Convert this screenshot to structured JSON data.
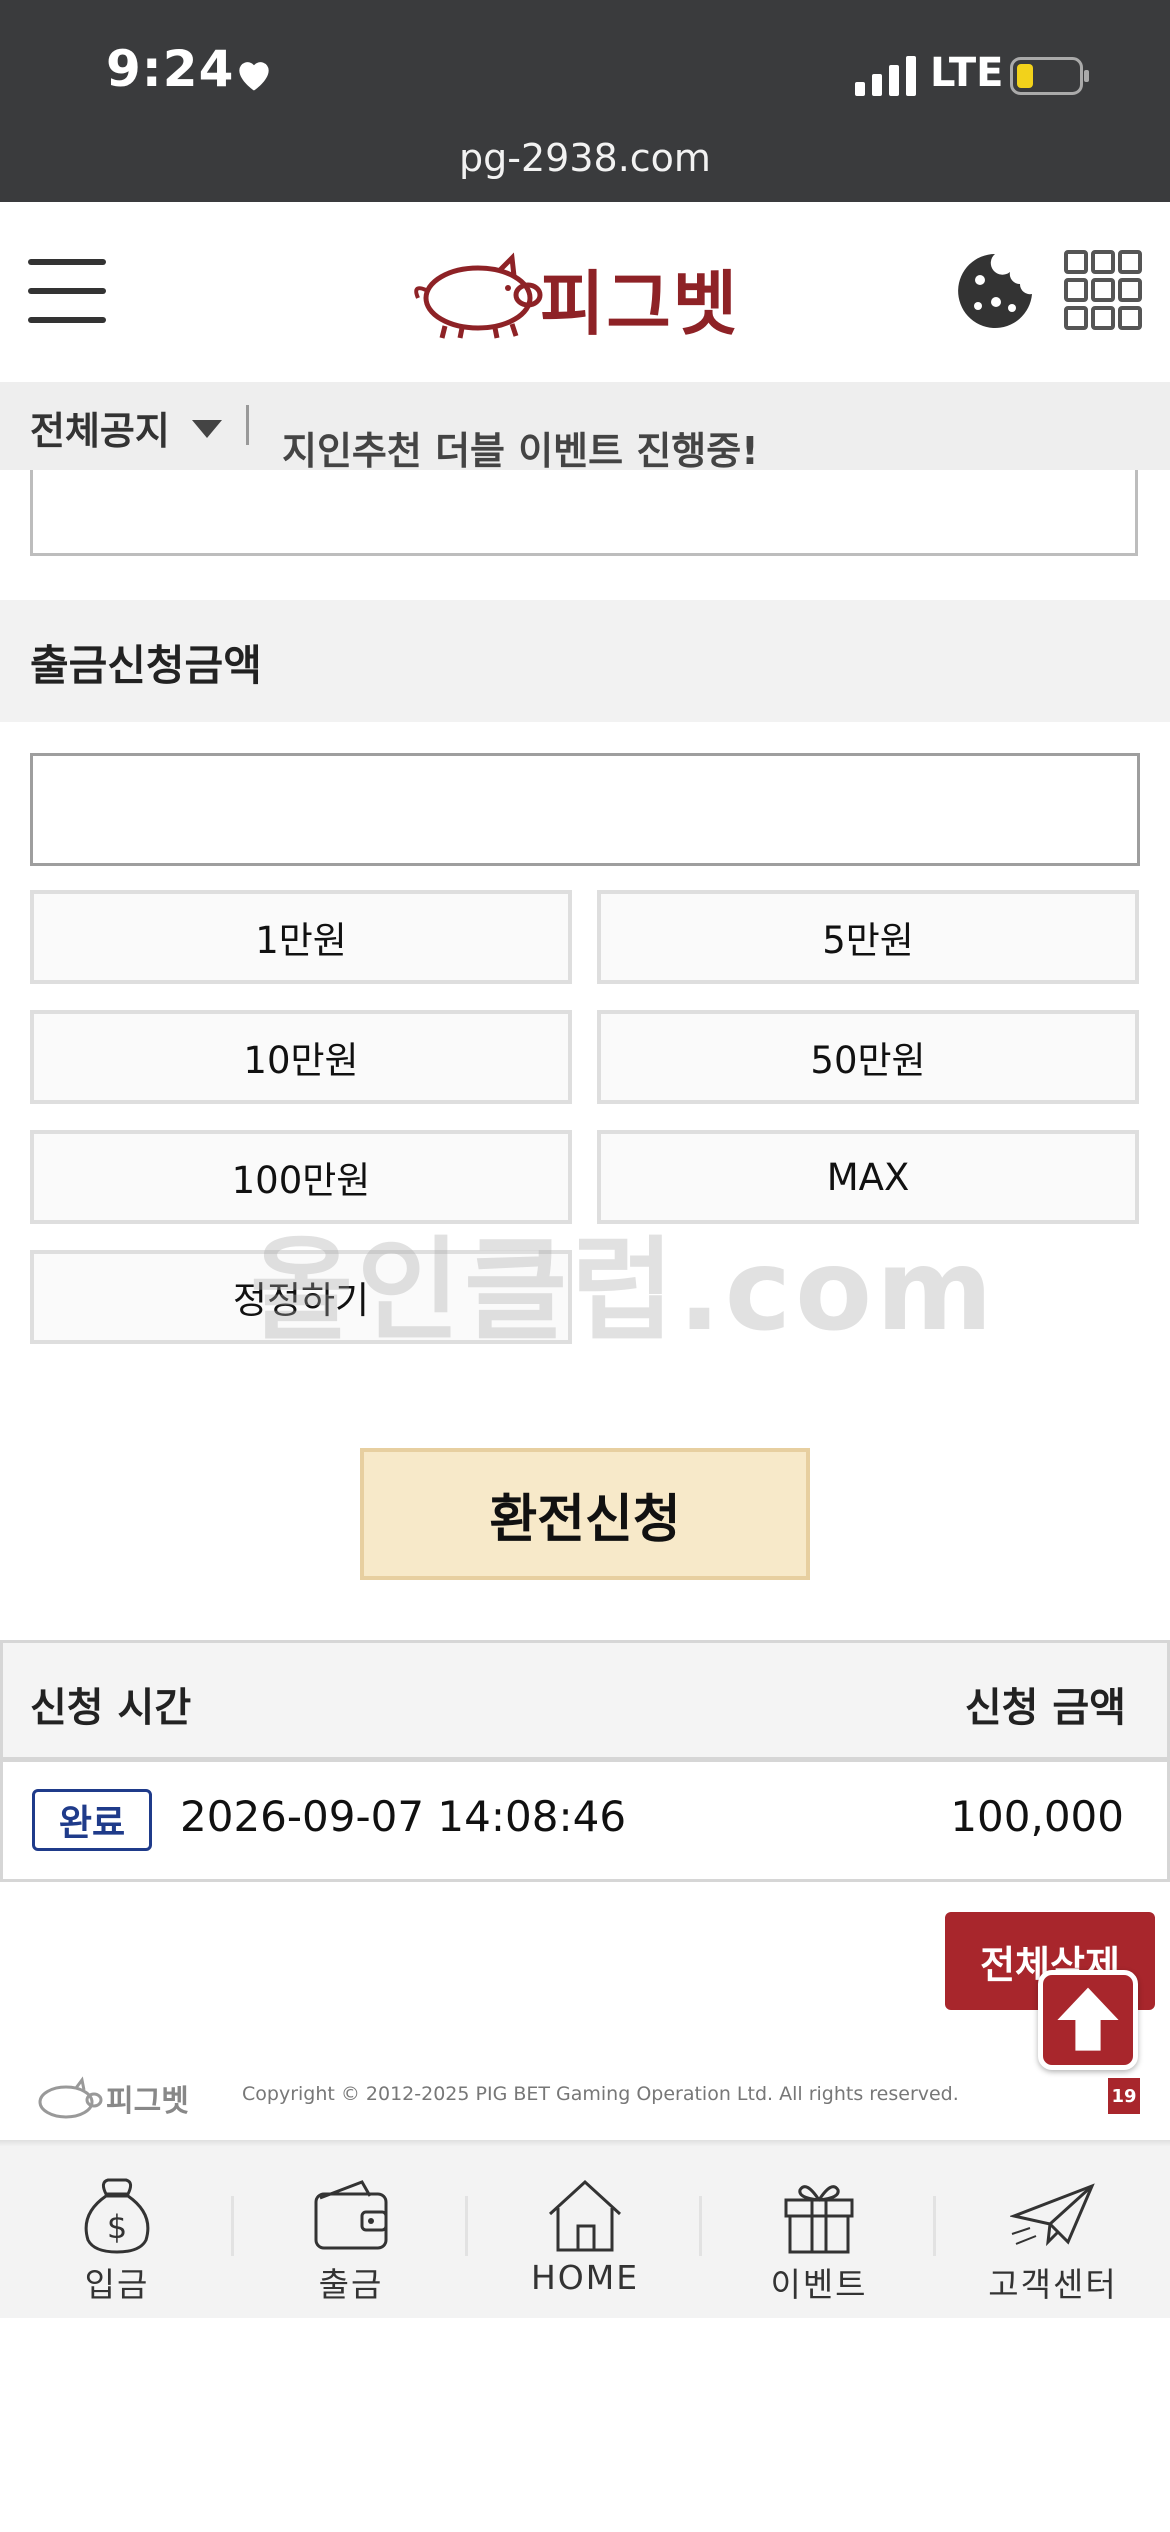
{
  "status_bar": {
    "time": "9:24",
    "network": "LTE",
    "url": "pg-2938.com"
  },
  "header": {
    "logo_text": "피그벳"
  },
  "notice": {
    "label": "전체공지",
    "text": "지인추천 더블 이벤트 진행중!"
  },
  "withdraw": {
    "section_title": "출금신청금액",
    "amount_value": "",
    "buttons": [
      "1만원",
      "5만원",
      "10만원",
      "50만원",
      "100만원",
      "MAX",
      "정정하기"
    ],
    "submit_label": "환전신청"
  },
  "watermark": "올인클럽.com",
  "history": {
    "header_time": "신청 시간",
    "header_amount": "신청 금액",
    "rows": [
      {
        "status": "완료",
        "time": "2026-09-07 14:08:46",
        "amount": "100,000"
      }
    ],
    "delete_all_label": "전체삭제"
  },
  "footer": {
    "logo_text": "피그벳",
    "copyright": "Copyright © 2012-2025 PIG BET Gaming Operation Ltd. All rights reserved.",
    "age_badge": "19"
  },
  "bottom_nav": [
    {
      "label": "입금",
      "icon": "money-bag-icon"
    },
    {
      "label": "출금",
      "icon": "wallet-icon"
    },
    {
      "label": "HOME",
      "icon": "house-icon"
    },
    {
      "label": "이벤트",
      "icon": "gift-icon"
    },
    {
      "label": "고객센터",
      "icon": "paper-plane-icon"
    }
  ],
  "colors": {
    "brand": "#a8262c",
    "submit_bg": "#f7e9c9",
    "badge": "#1f3b8a"
  }
}
